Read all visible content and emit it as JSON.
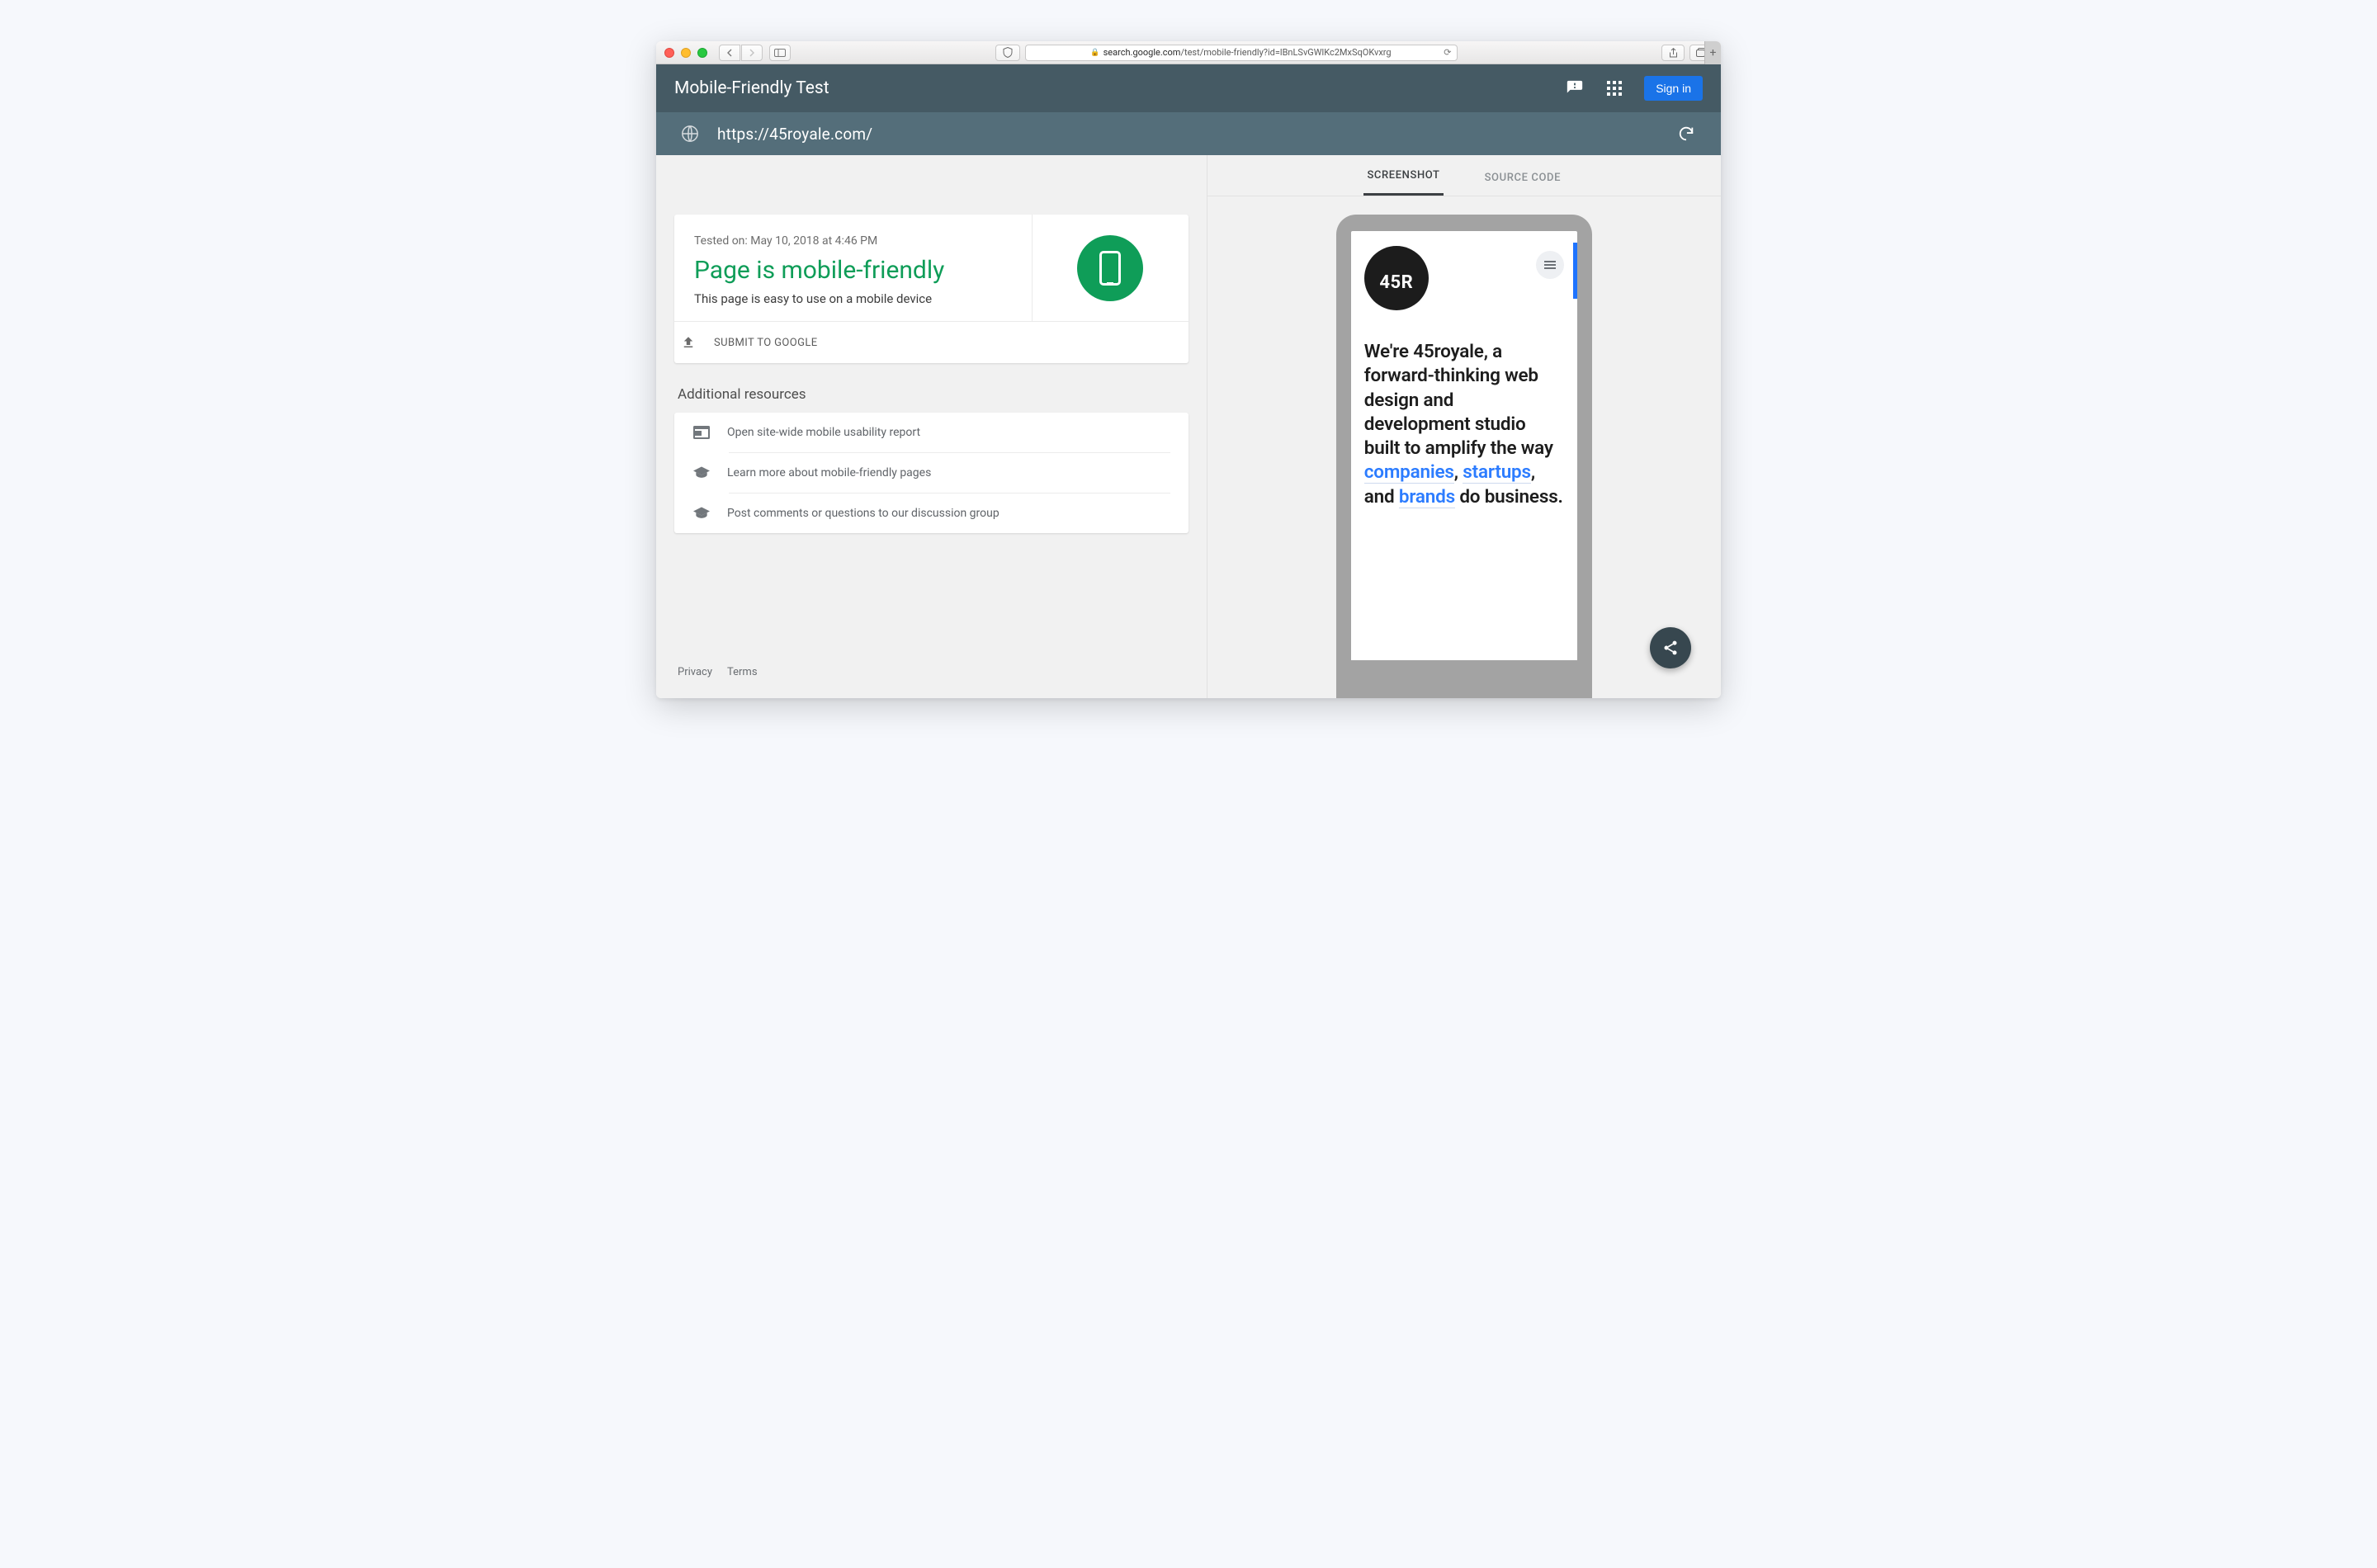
{
  "browser": {
    "address_host": "search.google.com",
    "address_path": "/test/mobile-friendly?id=lBnLSvGWlKc2MxSqOKvxrg"
  },
  "header": {
    "title": "Mobile-Friendly Test",
    "signin": "Sign in"
  },
  "testbar": {
    "url": "https://45royale.com/"
  },
  "result": {
    "tested_on": "Tested on: May 10, 2018 at 4:46 PM",
    "verdict": "Page is mobile-friendly",
    "subtext": "This page is easy to use on a mobile device",
    "submit_label": "SUBMIT TO GOOGLE"
  },
  "resources": {
    "title": "Additional resources",
    "items": [
      "Open site-wide mobile usability report",
      "Learn more about mobile-friendly pages",
      "Post comments or questions to our discussion group"
    ]
  },
  "footer": {
    "privacy": "Privacy",
    "terms": "Terms"
  },
  "tabs": {
    "screenshot": "SCREENSHOT",
    "source": "SOURCE CODE"
  },
  "preview": {
    "logo_text": "45R",
    "hero_pre": "We're 45royale, a forward-thinking web design and development studio built to amplify the way ",
    "link1": "companies",
    "sep1": ", ",
    "link2": "startups",
    "sep2": ", and ",
    "link3": "brands",
    "hero_post": " do business."
  }
}
